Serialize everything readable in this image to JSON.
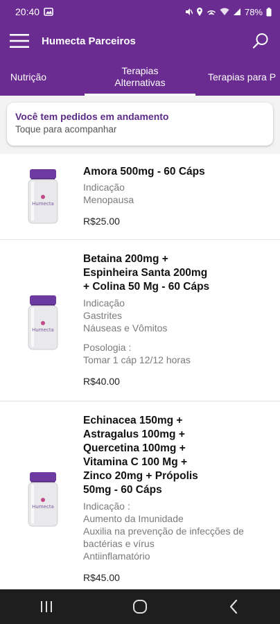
{
  "status_bar": {
    "time": "20:40",
    "battery": "78%"
  },
  "app_bar": {
    "title": "Humecta Parceiros",
    "menu_icon": "hamburger-menu-icon",
    "search_icon": "search-icon"
  },
  "tabs": [
    {
      "label": "Nutrição"
    },
    {
      "label_line1": "Terapias",
      "label_line2": "Alternativas"
    },
    {
      "label": "Terapias para P"
    }
  ],
  "notice": {
    "title": "Você tem pedidos em andamento",
    "subtitle": "Toque para acompanhar"
  },
  "products": [
    {
      "name": "Amora 500mg - 60 Cáps",
      "indication_label": "Indicação",
      "indication": [
        "Menopausa"
      ],
      "price": "R$25.00",
      "brand": "Humecta"
    },
    {
      "name_lines": [
        "Betaina 200mg +",
        "Espinheira Santa 200mg",
        "+ Colina 50 Mg - 60 Cáps"
      ],
      "indication_label": "Indicação",
      "indication": [
        "Gastrites",
        "Náuseas e Vômitos"
      ],
      "dosage_label": "Posologia :",
      "dosage": "Tomar 1 cáp 12/12 horas",
      "price": "R$40.00",
      "brand": "Humecta"
    },
    {
      "name_lines": [
        "Echinacea 150mg +",
        "Astragalus 100mg +",
        "Quercetina 100mg +",
        "Vitamina C 100 Mg +",
        "Zinco 20mg + Própolis",
        "50mg - 60 Cáps"
      ],
      "indication_label": "Indicação :",
      "indication": [
        "Aumento da Imunidade",
        "Auxilia na prevenção de infecções de",
        "bactérias e vírus",
        "Antiinflamatório"
      ],
      "price": "R$45.00",
      "brand": "Humecta"
    }
  ],
  "nav_bar": {
    "recents_icon": "recent-apps-icon",
    "home_icon": "home-icon",
    "back_icon": "back-icon"
  },
  "colors": {
    "primary": "#6a2c91",
    "accent_text": "#5b2a86",
    "background": "#f3f3f3"
  }
}
